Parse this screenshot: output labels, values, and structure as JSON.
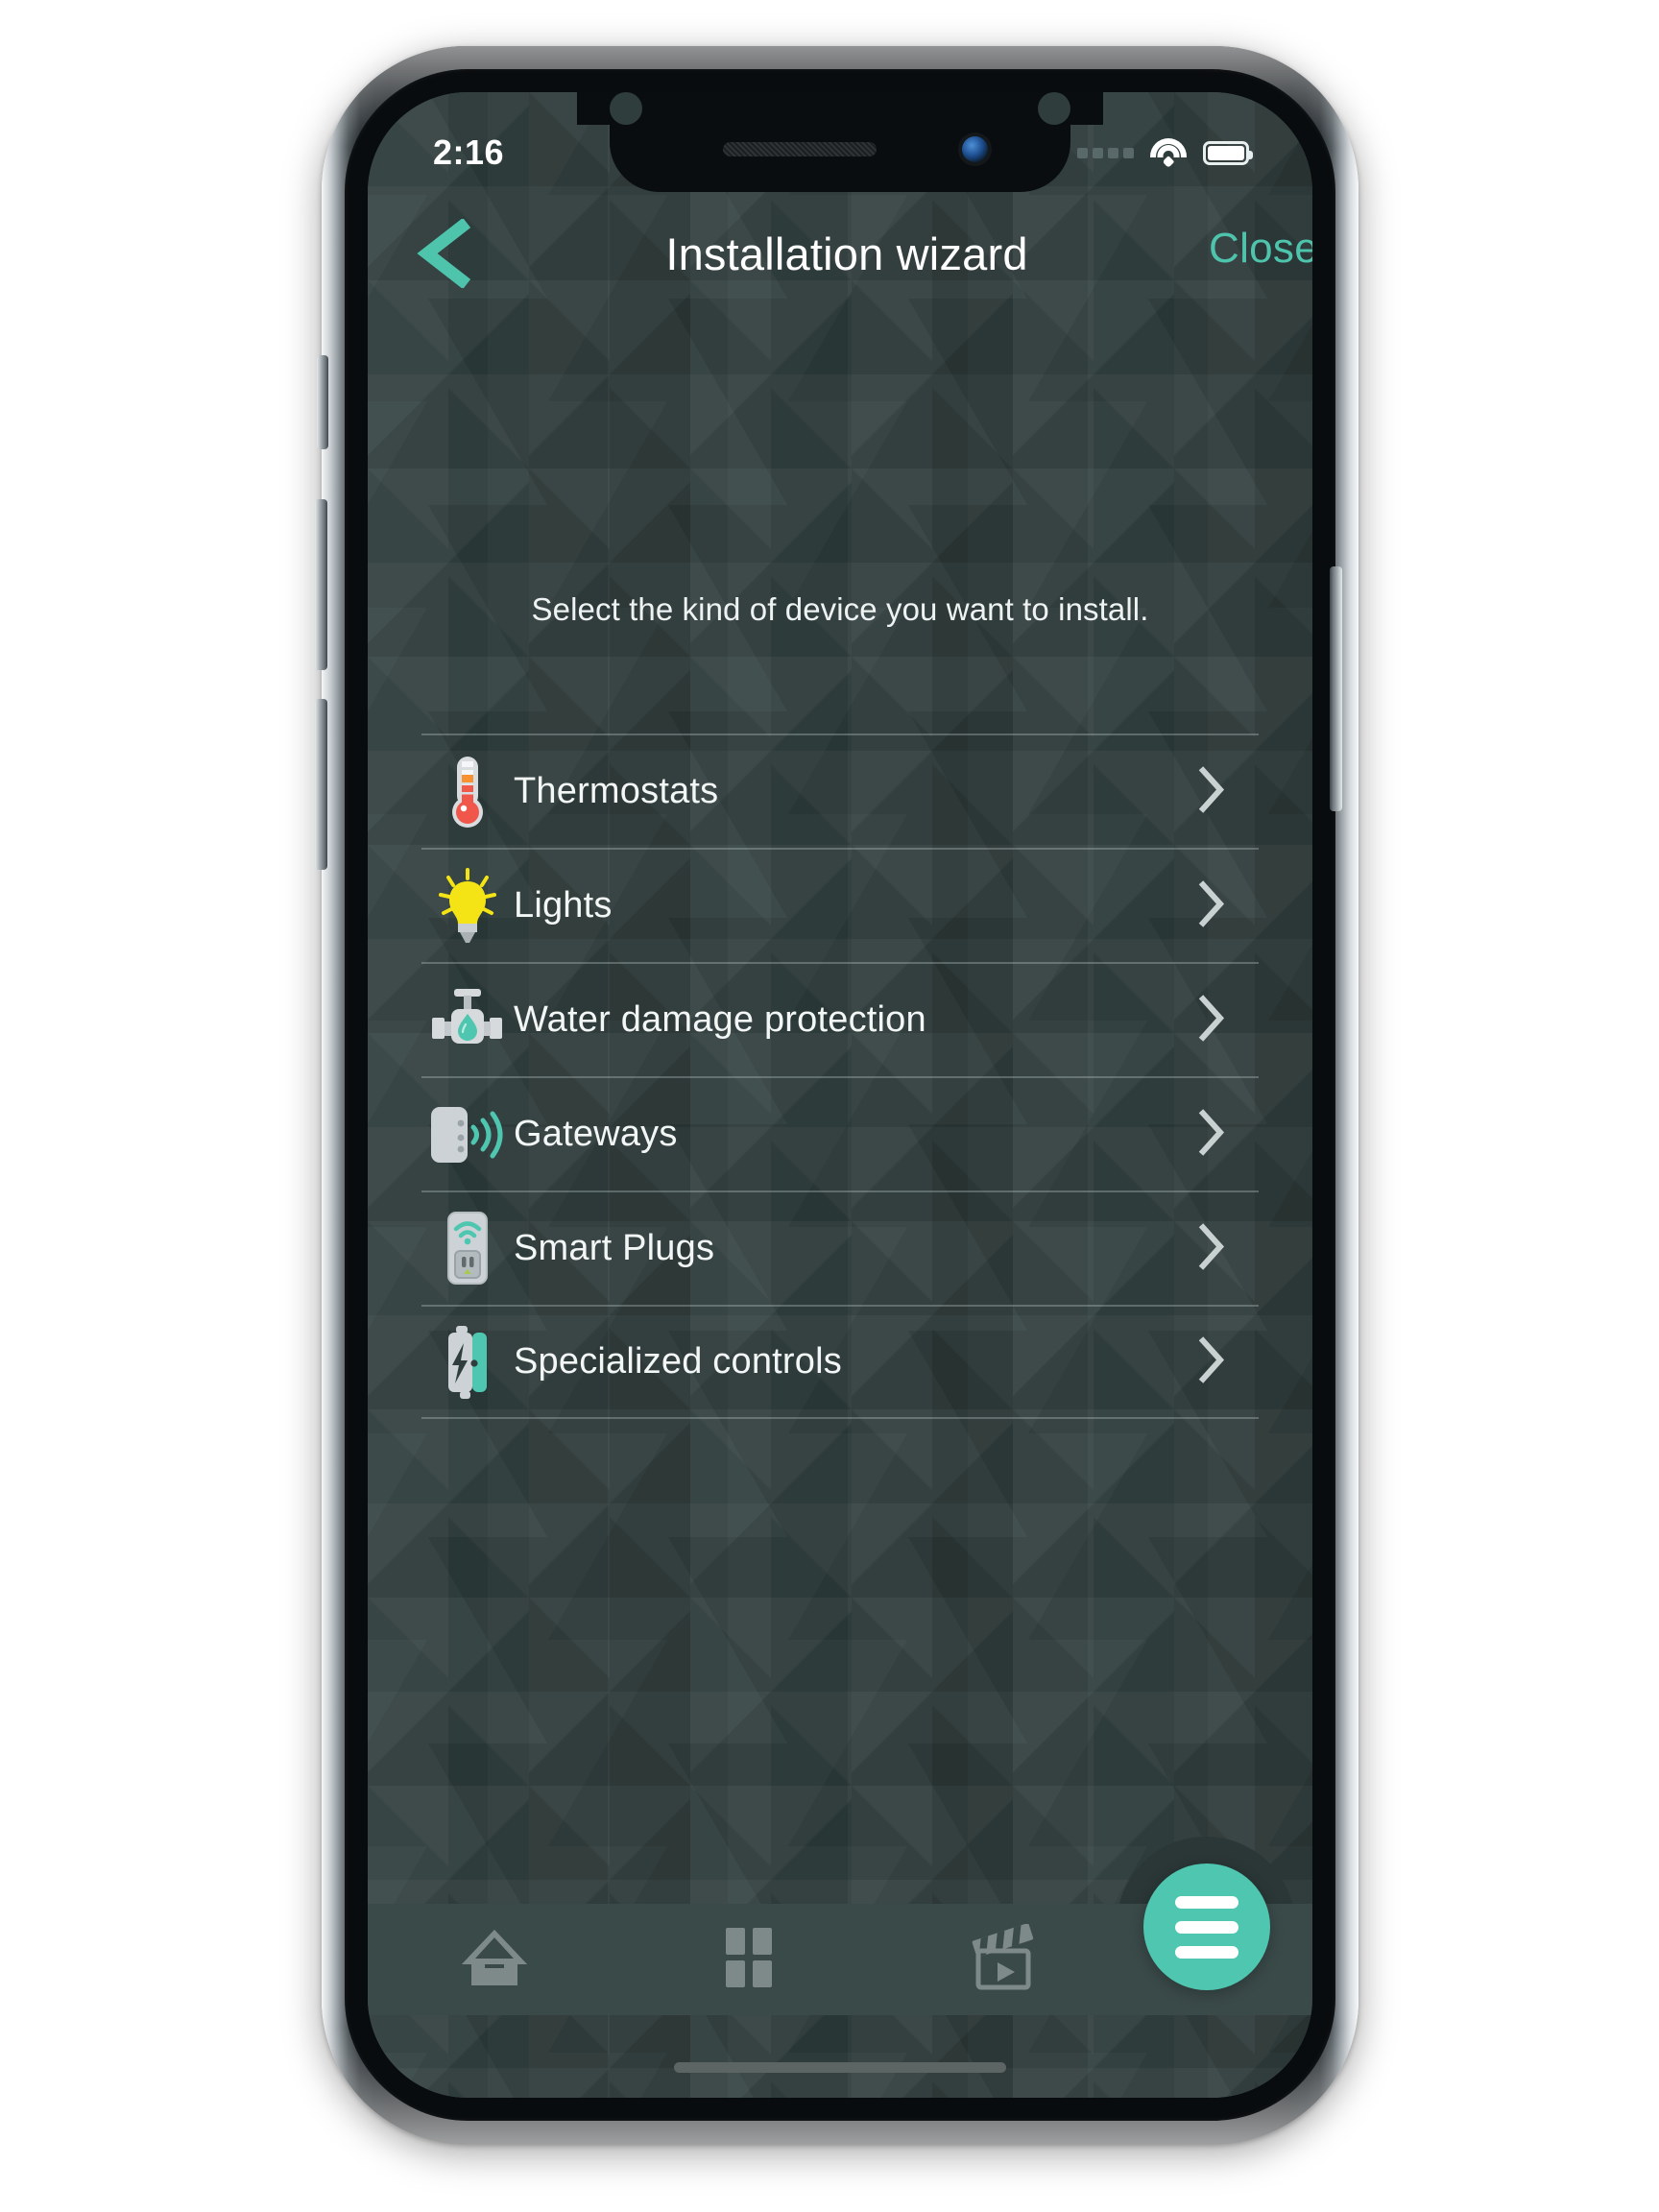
{
  "status_bar": {
    "time": "2:16",
    "signal_icon": "signal-dots-icon",
    "wifi_icon": "wifi-icon",
    "battery_icon": "battery-full-icon"
  },
  "header": {
    "back_icon": "chevron-left-icon",
    "title": "Installation wizard",
    "close_label": "Close",
    "accent_color": "#4fc4ad"
  },
  "content": {
    "subtitle": "Select the kind of device you want to install.",
    "items": [
      {
        "label": "Thermostats",
        "icon": "thermometer-icon",
        "chevron": "chevron-right-icon"
      },
      {
        "label": "Lights",
        "icon": "lightbulb-icon",
        "chevron": "chevron-right-icon"
      },
      {
        "label": "Water damage protection",
        "icon": "water-valve-icon",
        "chevron": "chevron-right-icon"
      },
      {
        "label": "Gateways",
        "icon": "gateway-signal-icon",
        "chevron": "chevron-right-icon"
      },
      {
        "label": "Smart Plugs",
        "icon": "smart-plug-icon",
        "chevron": "chevron-right-icon"
      },
      {
        "label": "Specialized controls",
        "icon": "power-bolt-device-icon",
        "chevron": "chevron-right-icon"
      }
    ]
  },
  "bottom_nav": {
    "tabs": [
      {
        "icon": "home-icon"
      },
      {
        "icon": "grid-icon"
      },
      {
        "icon": "clapperboard-icon"
      }
    ],
    "fab_icon": "hamburger-menu-icon",
    "fab_color": "#4ec6b0"
  },
  "theme": {
    "screen_background": "#2f3e3d",
    "bottom_bar_background": "#3a4a49",
    "text_primary": "#f2f6f5",
    "divider": "rgba(206,220,218,0.30)"
  }
}
